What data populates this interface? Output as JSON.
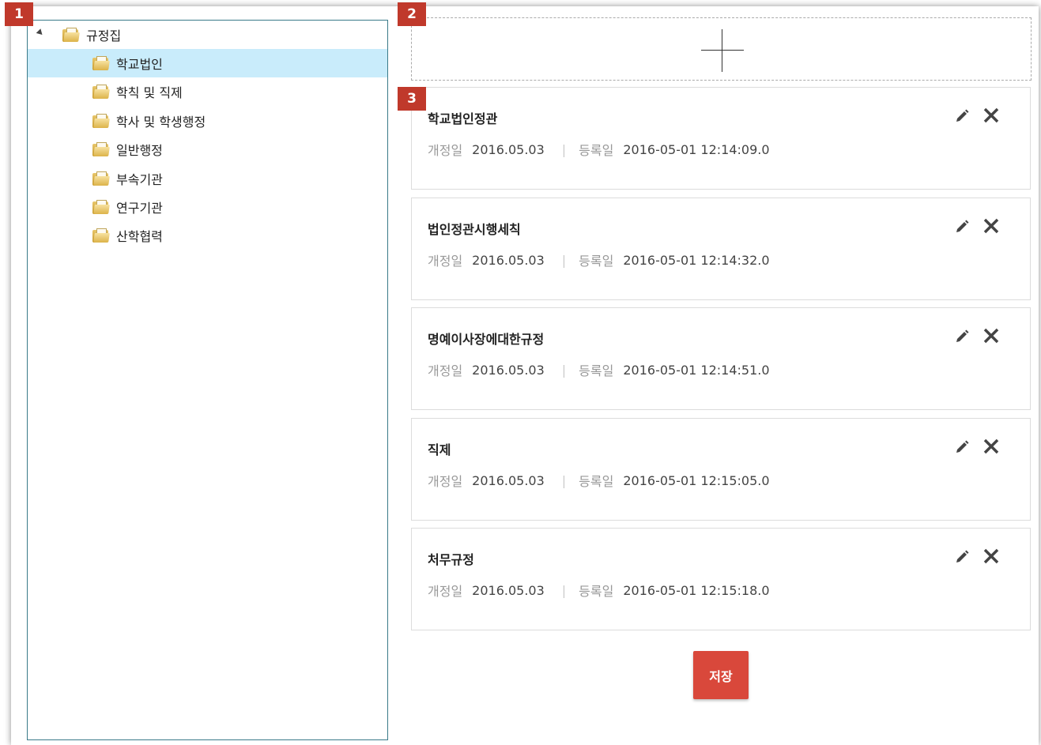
{
  "badges": [
    "1",
    "2",
    "3"
  ],
  "tree": {
    "root": {
      "label": "규정집",
      "icon": "folder-icon"
    },
    "items": [
      {
        "label": "학교법인",
        "icon": "folder-icon",
        "selected": true
      },
      {
        "label": "학칙 및 직제",
        "icon": "folder-icon",
        "selected": false
      },
      {
        "label": "학사 및 학생행정",
        "icon": "folder-icon",
        "selected": false
      },
      {
        "label": "일반행정",
        "icon": "folder-icon",
        "selected": false
      },
      {
        "label": "부속기관",
        "icon": "folder-icon",
        "selected": false
      },
      {
        "label": "연구기관",
        "icon": "folder-icon",
        "selected": false
      },
      {
        "label": "산학협력",
        "icon": "folder-icon",
        "selected": false
      }
    ]
  },
  "add_zone": {
    "icon": "plus-icon"
  },
  "meta_labels": {
    "revised": "개정일",
    "registered": "등록일",
    "separator": "|"
  },
  "documents": [
    {
      "title": "학교법인정관",
      "revised": "2016.05.03",
      "registered": "2016-05-01 12:14:09.0"
    },
    {
      "title": "법인정관시행세칙",
      "revised": "2016.05.03",
      "registered": "2016-05-01 12:14:32.0"
    },
    {
      "title": "명예이사장에대한규정",
      "revised": "2016.05.03",
      "registered": "2016-05-01 12:14:51.0"
    },
    {
      "title": "직제",
      "revised": "2016.05.03",
      "registered": "2016-05-01 12:15:05.0"
    },
    {
      "title": "처무규정",
      "revised": "2016.05.03",
      "registered": "2016-05-01 12:15:18.0"
    }
  ],
  "actions": {
    "edit_icon": "pencil-icon",
    "delete_icon": "close-icon",
    "save_label": "저장"
  },
  "colors": {
    "badge": "#c0392b",
    "selected_row": "#c9ecfb",
    "tree_border": "#3a7a89",
    "save_button": "#d9483b"
  }
}
